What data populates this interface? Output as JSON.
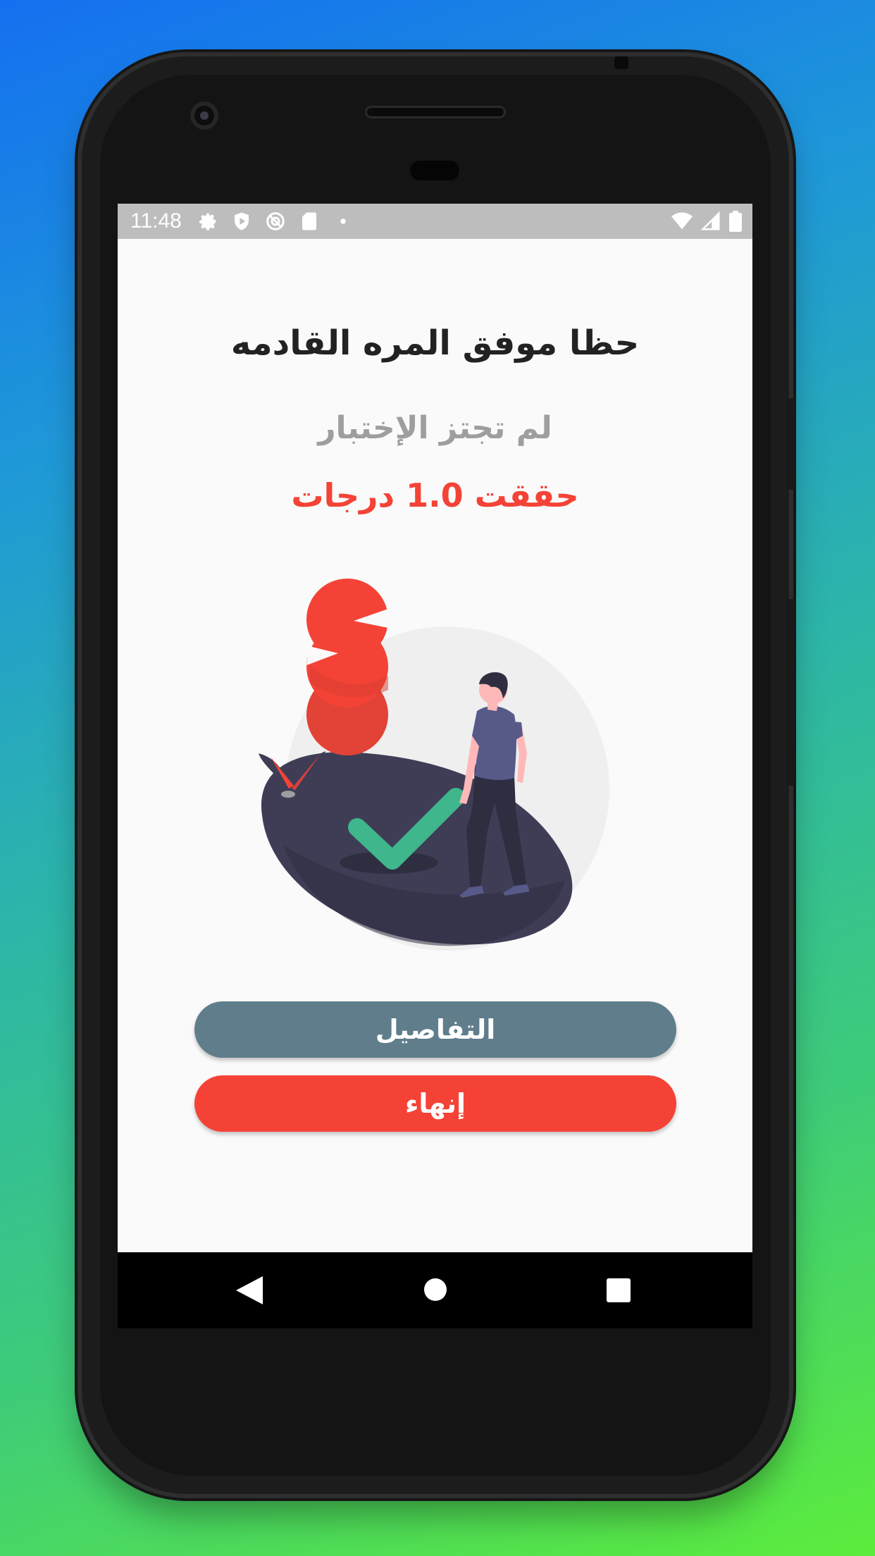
{
  "status_bar": {
    "time": "11:48",
    "icons": [
      "settings-icon",
      "shield-icon",
      "sync-disabled-icon",
      "sd-card-icon",
      "dot-icon"
    ],
    "right_icons": [
      "wifi-icon",
      "signal-icon",
      "battery-icon"
    ]
  },
  "result": {
    "title": "حظا موفق المره القادمه",
    "subtitle": "لم تجتز الإختبار",
    "score": "حققت 1.0 درجات"
  },
  "buttons": {
    "details_label": "التفاصيل",
    "finish_label": "إنهاء"
  },
  "navigation": {
    "back": "back-icon",
    "home": "home-icon",
    "recents": "recents-icon"
  },
  "colors": {
    "accent_red": "#f44336",
    "details_button": "#607d8b",
    "subtitle_gray": "#9e9e9e",
    "status_bar": "#bdbdbd"
  }
}
